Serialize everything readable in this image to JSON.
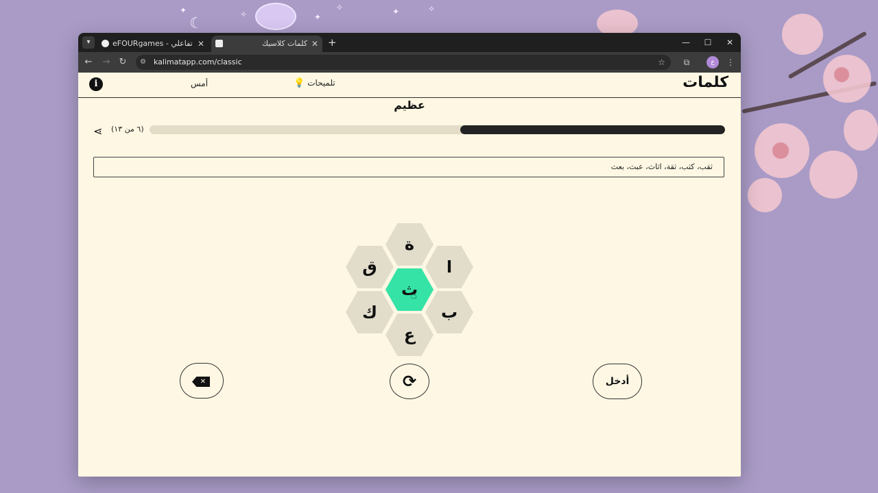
{
  "browser": {
    "tabs": [
      {
        "title": "eFOURgames - تحدي ألعاب تفاعلي",
        "active": false
      },
      {
        "title": "كلمات كلاسيك",
        "active": true
      }
    ],
    "new_tab_icon": "plus-icon",
    "url": "kalimatapp.com/classic",
    "profile_initial": "ع"
  },
  "app": {
    "logo": "كلمات",
    "hints_label": "تلميحات",
    "yesterday_label": "أمس",
    "info_icon": "i",
    "rank": "عظيم",
    "progress": {
      "label": "(٦ من ١٣)",
      "found": 6,
      "total": 13,
      "fraction": 0.46
    },
    "found_words": "ثقب، كثب، ثقة، اثاث، عبث، بعث",
    "letters": {
      "center": "ث",
      "top": "ة",
      "top_left": "ق",
      "top_right": "ا",
      "bottom_left": "ك",
      "bottom_right": "ب",
      "bottom": "ع"
    },
    "buttons": {
      "delete_icon": "backspace-icon",
      "shuffle_icon": "shuffle-icon",
      "enter_label": "أدخل"
    }
  },
  "colors": {
    "page_bg": "#fdf7e3",
    "center_hex": "#35e3a6",
    "outer_hex": "#e2dccb",
    "progress_fill": "#232323",
    "desktop_bg": "#a99bc6"
  }
}
